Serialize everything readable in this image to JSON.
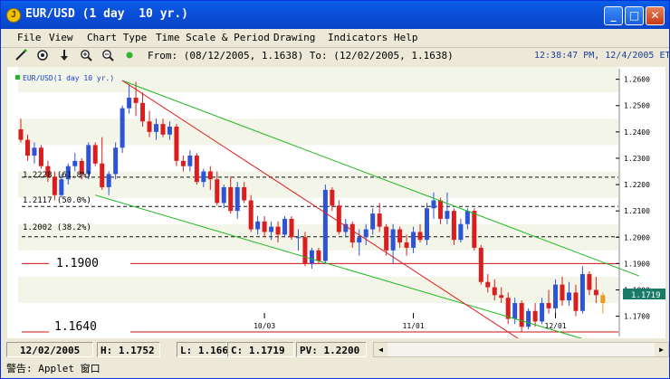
{
  "window": {
    "title": "EUR/USD (1 day  10 yr.)",
    "app_icon": "java-coffee-icon"
  },
  "title_buttons": {
    "minimize": "_",
    "maximize": "□",
    "close": "✕"
  },
  "menu": [
    "File",
    "View",
    "Chart Type",
    "Time Scale & Period",
    "Drawing",
    "Indicators",
    "Help"
  ],
  "toolbar": {
    "tools": [
      "draw-line-icon",
      "target-icon",
      "down-arrow-icon",
      "zoom-in-icon",
      "zoom-out-icon",
      "green-dot-icon"
    ],
    "range_text": "From: (08/12/2005, 1.1638) To: (12/02/2005, 1.1638)",
    "clock": "12:38:47 PM, 12/4/2005 ET"
  },
  "chart": {
    "legend": "EUR/USD(1 day  10 yr.)",
    "up_color": "#2E54D6",
    "down_color": "#D81E1E",
    "price_badge": "1.1719",
    "price_levels": [
      "1.2600",
      "1.2500",
      "1.2400",
      "1.2300",
      "1.2200",
      "1.2100",
      "1.2000",
      "1.1900",
      "1.1800",
      "1.1700"
    ],
    "fib_labels": [
      "1.2228 (61.8%)",
      "1.2117 (50.0%)",
      "1.2002 (38.2%)"
    ],
    "box_labels": [
      "1.1900",
      "1.1640"
    ],
    "date_labels": [
      "10/03",
      "11/01",
      "12/01"
    ]
  },
  "chart_data": {
    "type": "candlestick",
    "title": "EUR/USD(1 day  10 yr.)",
    "ylim": [
      1.164,
      1.265
    ],
    "y_ticks": [
      1.26,
      1.25,
      1.24,
      1.23,
      1.22,
      1.21,
      1.2,
      1.19,
      1.18,
      1.17
    ],
    "x_ticks": [
      "10/03",
      "11/01",
      "12/01"
    ],
    "horizontal_lines": [
      {
        "value": 1.2228,
        "label": "1.2228 (61.8%)",
        "style": "dashed"
      },
      {
        "value": 1.2117,
        "label": "1.2117 (50.0%)",
        "style": "dashed"
      },
      {
        "value": 1.2002,
        "label": "1.2002 (38.2%)",
        "style": "dashed"
      },
      {
        "value": 1.19,
        "label": "1.1900",
        "style": "solid-red"
      },
      {
        "value": 1.164,
        "label": "1.1640",
        "style": "solid-red"
      }
    ],
    "candles": [
      {
        "o": 1.241,
        "h": 1.245,
        "l": 1.236,
        "c": 1.237
      },
      {
        "o": 1.237,
        "h": 1.239,
        "l": 1.229,
        "c": 1.231
      },
      {
        "o": 1.231,
        "h": 1.236,
        "l": 1.228,
        "c": 1.234
      },
      {
        "o": 1.234,
        "h": 1.235,
        "l": 1.226,
        "c": 1.227
      },
      {
        "o": 1.227,
        "h": 1.229,
        "l": 1.221,
        "c": 1.223
      },
      {
        "o": 1.223,
        "h": 1.225,
        "l": 1.214,
        "c": 1.216
      },
      {
        "o": 1.216,
        "h": 1.224,
        "l": 1.215,
        "c": 1.222
      },
      {
        "o": 1.222,
        "h": 1.228,
        "l": 1.22,
        "c": 1.227
      },
      {
        "o": 1.227,
        "h": 1.232,
        "l": 1.225,
        "c": 1.229
      },
      {
        "o": 1.229,
        "h": 1.23,
        "l": 1.222,
        "c": 1.224
      },
      {
        "o": 1.224,
        "h": 1.236,
        "l": 1.222,
        "c": 1.235
      },
      {
        "o": 1.235,
        "h": 1.236,
        "l": 1.227,
        "c": 1.228
      },
      {
        "o": 1.228,
        "h": 1.238,
        "l": 1.218,
        "c": 1.219
      },
      {
        "o": 1.219,
        "h": 1.225,
        "l": 1.216,
        "c": 1.224
      },
      {
        "o": 1.224,
        "h": 1.236,
        "l": 1.222,
        "c": 1.234
      },
      {
        "o": 1.234,
        "h": 1.25,
        "l": 1.232,
        "c": 1.249
      },
      {
        "o": 1.249,
        "h": 1.258,
        "l": 1.247,
        "c": 1.253
      },
      {
        "o": 1.253,
        "h": 1.259,
        "l": 1.246,
        "c": 1.251
      },
      {
        "o": 1.251,
        "h": 1.255,
        "l": 1.242,
        "c": 1.244
      },
      {
        "o": 1.244,
        "h": 1.248,
        "l": 1.238,
        "c": 1.24
      },
      {
        "o": 1.24,
        "h": 1.245,
        "l": 1.237,
        "c": 1.243
      },
      {
        "o": 1.243,
        "h": 1.245,
        "l": 1.238,
        "c": 1.239
      },
      {
        "o": 1.239,
        "h": 1.244,
        "l": 1.237,
        "c": 1.242
      },
      {
        "o": 1.242,
        "h": 1.243,
        "l": 1.227,
        "c": 1.229
      },
      {
        "o": 1.229,
        "h": 1.231,
        "l": 1.225,
        "c": 1.227
      },
      {
        "o": 1.227,
        "h": 1.233,
        "l": 1.225,
        "c": 1.231
      },
      {
        "o": 1.231,
        "h": 1.232,
        "l": 1.22,
        "c": 1.221
      },
      {
        "o": 1.221,
        "h": 1.226,
        "l": 1.219,
        "c": 1.225
      },
      {
        "o": 1.225,
        "h": 1.227,
        "l": 1.218,
        "c": 1.222
      },
      {
        "o": 1.222,
        "h": 1.225,
        "l": 1.212,
        "c": 1.213
      },
      {
        "o": 1.213,
        "h": 1.22,
        "l": 1.211,
        "c": 1.219
      },
      {
        "o": 1.219,
        "h": 1.223,
        "l": 1.209,
        "c": 1.21
      },
      {
        "o": 1.21,
        "h": 1.221,
        "l": 1.207,
        "c": 1.219
      },
      {
        "o": 1.219,
        "h": 1.221,
        "l": 1.213,
        "c": 1.214
      },
      {
        "o": 1.214,
        "h": 1.216,
        "l": 1.202,
        "c": 1.203
      },
      {
        "o": 1.203,
        "h": 1.208,
        "l": 1.201,
        "c": 1.206
      },
      {
        "o": 1.206,
        "h": 1.208,
        "l": 1.2,
        "c": 1.202
      },
      {
        "o": 1.202,
        "h": 1.206,
        "l": 1.199,
        "c": 1.204
      },
      {
        "o": 1.204,
        "h": 1.206,
        "l": 1.198,
        "c": 1.201
      },
      {
        "o": 1.201,
        "h": 1.208,
        "l": 1.2,
        "c": 1.207
      },
      {
        "o": 1.207,
        "h": 1.208,
        "l": 1.199,
        "c": 1.2
      },
      {
        "o": 1.2,
        "h": 1.203,
        "l": 1.195,
        "c": 1.2
      },
      {
        "o": 1.2,
        "h": 1.202,
        "l": 1.189,
        "c": 1.19
      },
      {
        "o": 1.19,
        "h": 1.196,
        "l": 1.188,
        "c": 1.195
      },
      {
        "o": 1.195,
        "h": 1.196,
        "l": 1.19,
        "c": 1.191
      },
      {
        "o": 1.191,
        "h": 1.22,
        "l": 1.19,
        "c": 1.218
      },
      {
        "o": 1.218,
        "h": 1.219,
        "l": 1.21,
        "c": 1.212
      },
      {
        "o": 1.212,
        "h": 1.214,
        "l": 1.201,
        "c": 1.202
      },
      {
        "o": 1.202,
        "h": 1.207,
        "l": 1.2,
        "c": 1.205
      },
      {
        "o": 1.205,
        "h": 1.206,
        "l": 1.196,
        "c": 1.198
      },
      {
        "o": 1.198,
        "h": 1.203,
        "l": 1.193,
        "c": 1.2
      },
      {
        "o": 1.2,
        "h": 1.205,
        "l": 1.197,
        "c": 1.203
      },
      {
        "o": 1.203,
        "h": 1.211,
        "l": 1.201,
        "c": 1.209
      },
      {
        "o": 1.209,
        "h": 1.213,
        "l": 1.202,
        "c": 1.204
      },
      {
        "o": 1.204,
        "h": 1.205,
        "l": 1.193,
        "c": 1.195
      },
      {
        "o": 1.195,
        "h": 1.205,
        "l": 1.19,
        "c": 1.203
      },
      {
        "o": 1.203,
        "h": 1.204,
        "l": 1.196,
        "c": 1.198
      },
      {
        "o": 1.198,
        "h": 1.201,
        "l": 1.193,
        "c": 1.196
      },
      {
        "o": 1.196,
        "h": 1.204,
        "l": 1.194,
        "c": 1.202
      },
      {
        "o": 1.202,
        "h": 1.205,
        "l": 1.198,
        "c": 1.199
      },
      {
        "o": 1.199,
        "h": 1.213,
        "l": 1.197,
        "c": 1.211
      },
      {
        "o": 1.211,
        "h": 1.217,
        "l": 1.207,
        "c": 1.214
      },
      {
        "o": 1.214,
        "h": 1.215,
        "l": 1.205,
        "c": 1.207
      },
      {
        "o": 1.207,
        "h": 1.217,
        "l": 1.205,
        "c": 1.21
      },
      {
        "o": 1.21,
        "h": 1.211,
        "l": 1.197,
        "c": 1.199
      },
      {
        "o": 1.199,
        "h": 1.207,
        "l": 1.198,
        "c": 1.205
      },
      {
        "o": 1.205,
        "h": 1.211,
        "l": 1.203,
        "c": 1.21
      },
      {
        "o": 1.21,
        "h": 1.211,
        "l": 1.195,
        "c": 1.196
      },
      {
        "o": 1.196,
        "h": 1.197,
        "l": 1.182,
        "c": 1.183
      },
      {
        "o": 1.183,
        "h": 1.186,
        "l": 1.179,
        "c": 1.181
      },
      {
        "o": 1.181,
        "h": 1.184,
        "l": 1.176,
        "c": 1.178
      },
      {
        "o": 1.178,
        "h": 1.181,
        "l": 1.175,
        "c": 1.177
      },
      {
        "o": 1.177,
        "h": 1.179,
        "l": 1.167,
        "c": 1.169
      },
      {
        "o": 1.169,
        "h": 1.177,
        "l": 1.167,
        "c": 1.175
      },
      {
        "o": 1.175,
        "h": 1.176,
        "l": 1.164,
        "c": 1.166
      },
      {
        "o": 1.166,
        "h": 1.173,
        "l": 1.165,
        "c": 1.172
      },
      {
        "o": 1.172,
        "h": 1.175,
        "l": 1.166,
        "c": 1.168
      },
      {
        "o": 1.168,
        "h": 1.177,
        "l": 1.167,
        "c": 1.175
      },
      {
        "o": 1.175,
        "h": 1.18,
        "l": 1.171,
        "c": 1.173
      },
      {
        "o": 1.173,
        "h": 1.184,
        "l": 1.171,
        "c": 1.182
      },
      {
        "o": 1.182,
        "h": 1.185,
        "l": 1.174,
        "c": 1.176
      },
      {
        "o": 1.176,
        "h": 1.183,
        "l": 1.174,
        "c": 1.179
      },
      {
        "o": 1.179,
        "h": 1.182,
        "l": 1.17,
        "c": 1.172
      },
      {
        "o": 1.172,
        "h": 1.189,
        "l": 1.171,
        "c": 1.186
      },
      {
        "o": 1.186,
        "h": 1.187,
        "l": 1.178,
        "c": 1.18
      },
      {
        "o": 1.18,
        "h": 1.185,
        "l": 1.175,
        "c": 1.178
      },
      {
        "o": 1.178,
        "h": 1.179,
        "l": 1.171,
        "c": 1.175
      }
    ],
    "date_tick_candle_index": [
      36,
      58,
      79
    ],
    "trendlines": [
      {
        "color": "#1FB81F",
        "from": {
          "i": 15,
          "v": 1.2595
        },
        "to": {
          "i": 86,
          "v": 1.1905
        }
      },
      {
        "color": "#1FB81F",
        "from": {
          "i": 11,
          "v": 1.216
        },
        "to": {
          "i": 82,
          "v": 1.1622
        }
      },
      {
        "color": "#E02020",
        "from": {
          "i": 15,
          "v": 1.2595
        },
        "to": {
          "i": 72,
          "v": 1.164
        }
      }
    ],
    "last_candle_color": "#F09A20"
  },
  "status": {
    "date": "12/02/2005",
    "high": "H: 1.1752",
    "low": "L: 1.1660",
    "close": "C: 1.1719",
    "pv": "PV: 1.2200"
  },
  "applet_status": "警告: Applet 窗口"
}
